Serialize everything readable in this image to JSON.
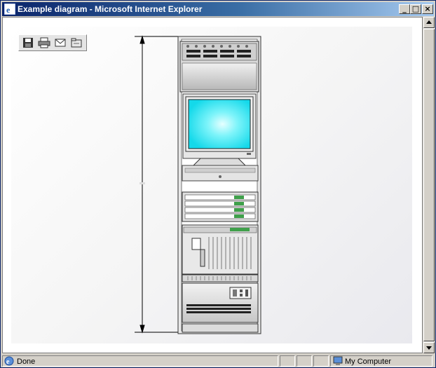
{
  "window": {
    "title": "Example diagram - Microsoft Internet Explorer",
    "min_label": "_",
    "max_label": "□",
    "close_label": "×"
  },
  "toolbar": {
    "items": [
      {
        "name": "save",
        "icon": "floppy-disk-icon"
      },
      {
        "name": "print",
        "icon": "printer-icon"
      },
      {
        "name": "email",
        "icon": "envelope-icon"
      },
      {
        "name": "open-folder",
        "icon": "folder-icon"
      }
    ]
  },
  "diagram": {
    "description_icons": [
      "server-rack",
      "crt-monitor",
      "disk-array",
      "power-unit"
    ],
    "monitor_screen_color": "#22e3f0",
    "dimension_line_color": "#000000"
  },
  "status": {
    "text": "Done",
    "zone": "My Computer"
  }
}
